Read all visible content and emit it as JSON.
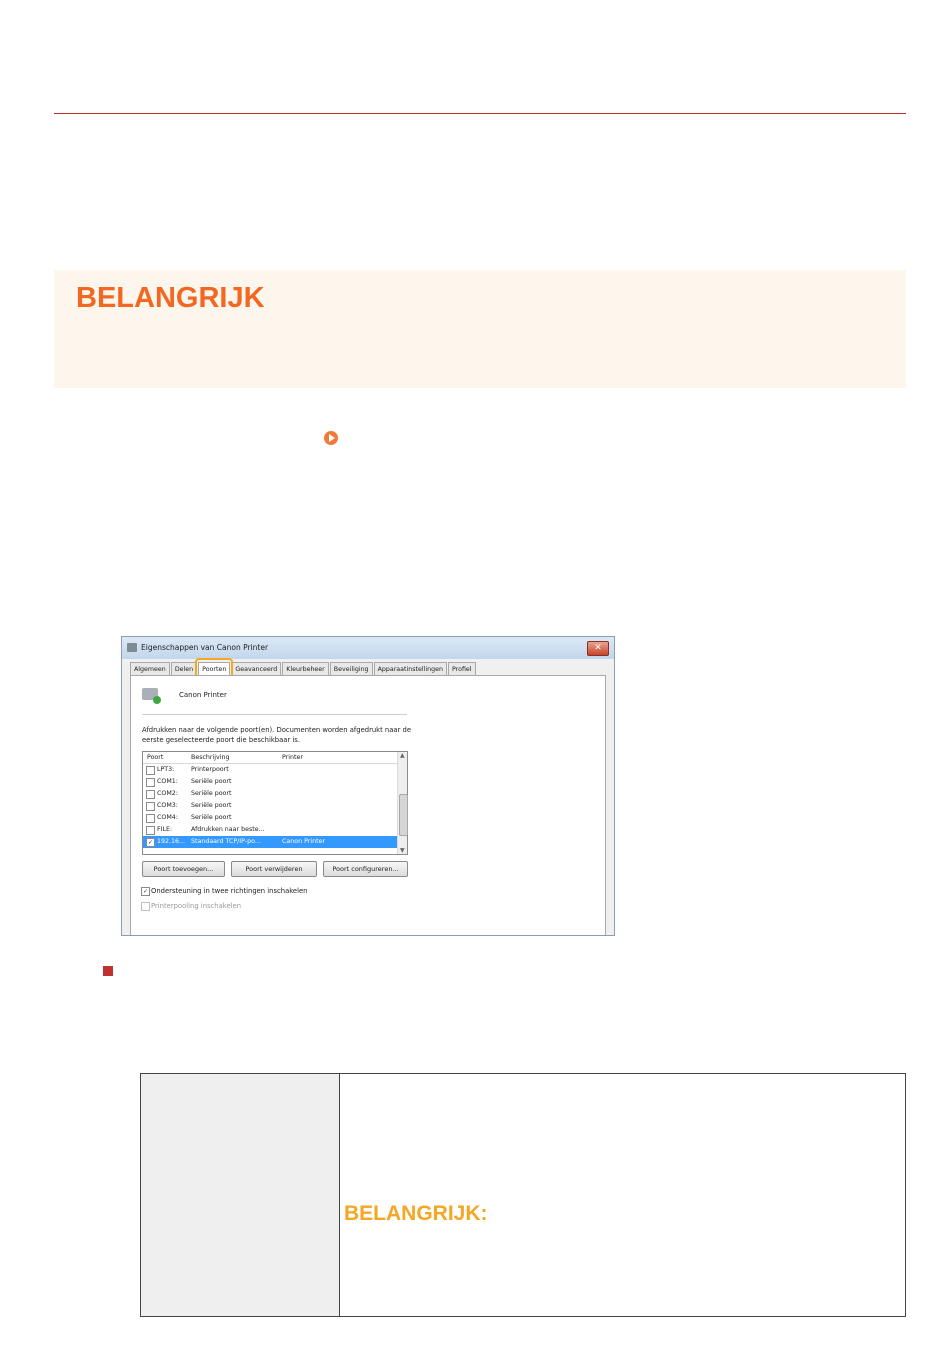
{
  "important_box": {
    "title": "BELANGRIJK"
  },
  "dialog": {
    "title": "Eigenschappen van Canon Printer",
    "close_label": "✕",
    "tabs": [
      "Algemeen",
      "Delen",
      "Poorten",
      "Geavanceerd",
      "Kleurbeheer",
      "Beveiliging",
      "Apparaatinstellingen",
      "Profiel"
    ],
    "active_tab": "Poorten",
    "printer_name": "Canon Printer",
    "description": "Afdrukken naar de volgende poort(en). Documenten worden afgedrukt naar de eerste geselecteerde poort die beschikbaar is.",
    "columns": {
      "port": "Poort",
      "description": "Beschrijving",
      "printer": "Printer"
    },
    "ports": [
      {
        "port": "LPT3:",
        "description": "Printerpoort",
        "printer": "",
        "checked": false,
        "selected": false
      },
      {
        "port": "COM1:",
        "description": "Seriële poort",
        "printer": "",
        "checked": false,
        "selected": false
      },
      {
        "port": "COM2:",
        "description": "Seriële poort",
        "printer": "",
        "checked": false,
        "selected": false
      },
      {
        "port": "COM3:",
        "description": "Seriële poort",
        "printer": "",
        "checked": false,
        "selected": false
      },
      {
        "port": "COM4:",
        "description": "Seriële poort",
        "printer": "",
        "checked": false,
        "selected": false
      },
      {
        "port": "FILE:",
        "description": "Afdrukken naar beste...",
        "printer": "",
        "checked": false,
        "selected": false
      },
      {
        "port": "192.16...",
        "description": "Standaard TCP/IP-po...",
        "printer": "Canon Printer",
        "checked": true,
        "selected": true
      }
    ],
    "buttons": {
      "add": "Poort toevoegen...",
      "remove": "Poort verwijderen",
      "configure": "Poort configureren..."
    },
    "bidirectional_label": "Ondersteuning in twee richtingen inschakelen",
    "pooling_label": "Printerpooling inschakelen",
    "check_mark": "✓"
  },
  "info_table": {
    "right_title": "BELANGRIJK:"
  },
  "colors": {
    "accent_red": "#c0302f",
    "orange": "#f26722",
    "amber": "#f5a623",
    "selection_blue": "#3399ff"
  }
}
